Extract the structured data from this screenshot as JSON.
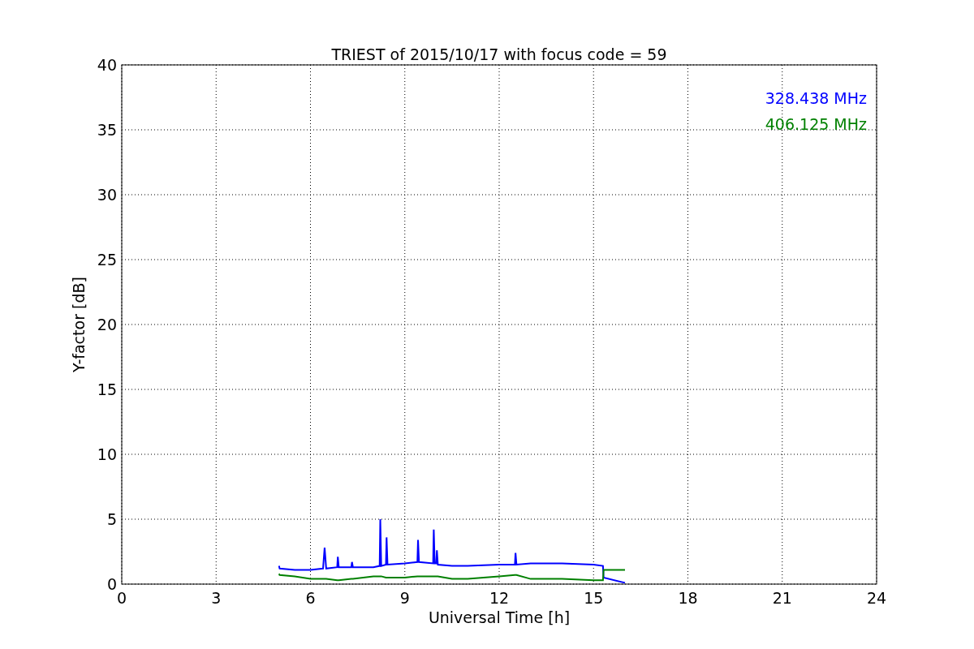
{
  "chart_data": {
    "type": "line",
    "title": "TRIEST of 2015/10/17 with focus code = 59",
    "xlabel": "Universal Time [h]",
    "ylabel": "Y-factor [dB]",
    "x": [
      5.0,
      5.02,
      5.5,
      6.0,
      6.4,
      6.45,
      6.5,
      6.85,
      6.87,
      6.9,
      7.3,
      7.32,
      7.35,
      8.0,
      8.2,
      8.22,
      8.25,
      8.4,
      8.42,
      8.45,
      9.0,
      9.4,
      9.42,
      9.45,
      9.9,
      9.92,
      9.95,
      10.0,
      10.02,
      10.05,
      10.5,
      11.0,
      12.0,
      12.5,
      12.52,
      12.55,
      13.0,
      14.0,
      15.0,
      15.3,
      15.32,
      16.0
    ],
    "series": [
      {
        "name": "328.438 MHz",
        "color": "#0000ff",
        "values": [
          1.4,
          1.2,
          1.1,
          1.1,
          1.2,
          2.8,
          1.2,
          1.3,
          2.1,
          1.3,
          1.3,
          1.7,
          1.3,
          1.3,
          1.4,
          5.0,
          1.4,
          1.5,
          3.6,
          1.5,
          1.6,
          1.7,
          3.4,
          1.7,
          1.6,
          4.2,
          1.6,
          1.6,
          2.6,
          1.5,
          1.4,
          1.4,
          1.5,
          1.5,
          2.4,
          1.5,
          1.6,
          1.6,
          1.5,
          1.4,
          0.5,
          0.1
        ]
      },
      {
        "name": "406.125 MHz",
        "color": "#008000",
        "values": [
          0.8,
          0.7,
          0.6,
          0.4,
          0.4,
          0.4,
          0.4,
          0.3,
          0.3,
          0.3,
          0.4,
          0.4,
          0.4,
          0.6,
          0.6,
          0.6,
          0.6,
          0.5,
          0.5,
          0.5,
          0.5,
          0.6,
          0.6,
          0.6,
          0.6,
          0.6,
          0.6,
          0.6,
          0.6,
          0.6,
          0.4,
          0.4,
          0.6,
          0.7,
          0.7,
          0.7,
          0.4,
          0.4,
          0.3,
          0.3,
          1.1,
          1.1
        ]
      }
    ],
    "xlim": [
      0,
      24
    ],
    "ylim": [
      0,
      40
    ],
    "xticks": [
      0,
      3,
      6,
      9,
      12,
      15,
      18,
      21,
      24
    ],
    "yticks": [
      0,
      5,
      10,
      15,
      20,
      25,
      30,
      35,
      40
    ],
    "grid": true
  }
}
